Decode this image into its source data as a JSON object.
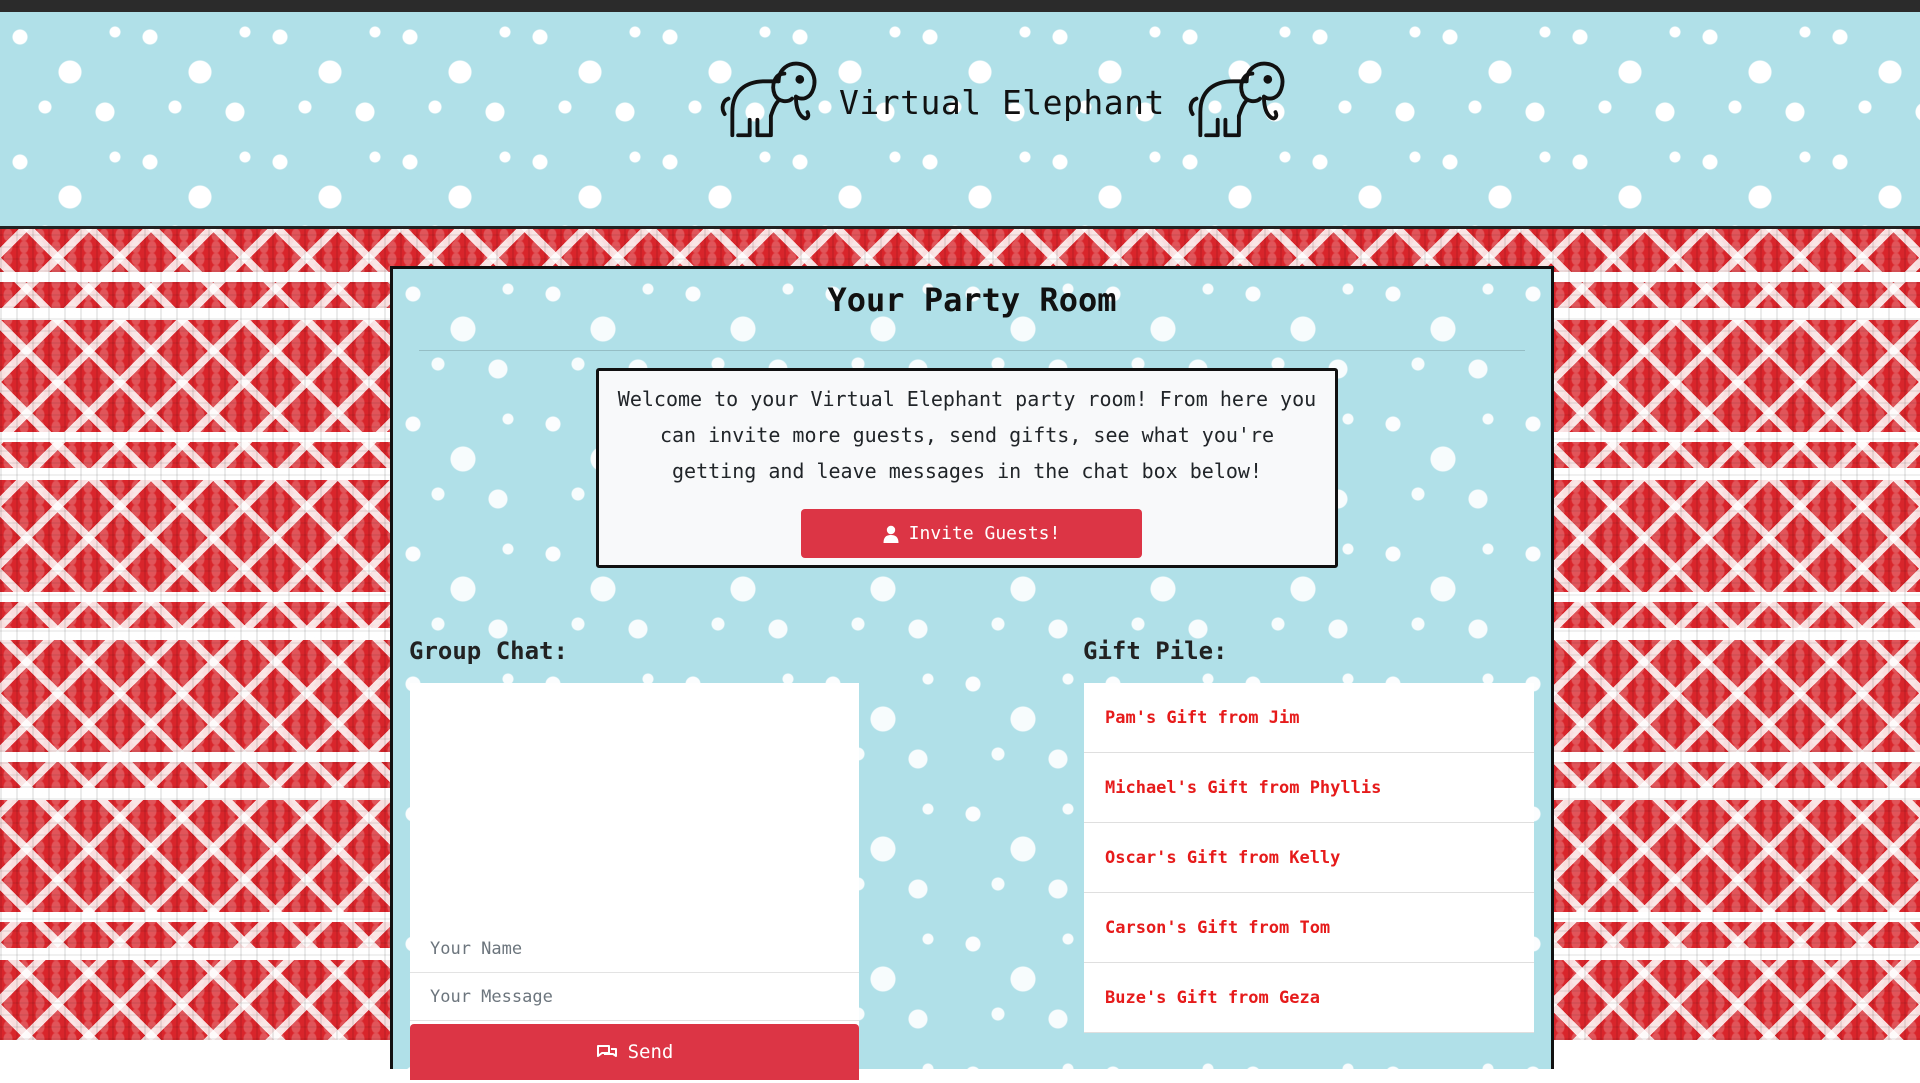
{
  "header": {
    "title": "Virtual Elephant",
    "logo_icon": "elephant-icon"
  },
  "room": {
    "heading": "Your Party Room",
    "welcome_text": "Welcome to your Virtual Elephant party room! From here you can invite more guests, send gifts, see what you're getting and leave messages in the chat box below!",
    "invite_button": {
      "label": "Invite Guests!",
      "icon": "user-icon"
    }
  },
  "chat": {
    "label": "Group Chat:",
    "name_placeholder": "Your Name",
    "name_value": "",
    "message_placeholder": "Your Message",
    "message_value": "",
    "send_button": {
      "label": "Send",
      "icon": "chat-bubbles-icon"
    }
  },
  "gifts": {
    "label": "Gift Pile:",
    "items": [
      "Pam's Gift from Jim",
      "Michael's Gift from Phyllis",
      "Oscar's Gift from Kelly",
      "Carson's Gift from Tom",
      "Buze's Gift from Geza"
    ]
  },
  "colors": {
    "accent_red": "#dc3545",
    "gift_link_red": "#e61b1b",
    "snow_background": "#b0e0e8",
    "sweater_red": "#d9252b"
  }
}
